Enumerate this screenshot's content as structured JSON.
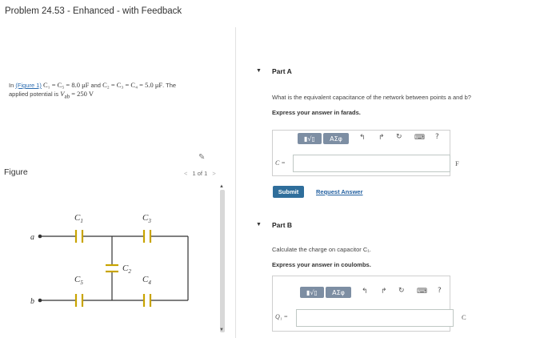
{
  "header": {
    "title": "Problem 24.53 - Enhanced - with Feedback"
  },
  "problem": {
    "intro": "In",
    "figure_link": "(Figure 1)",
    "caps1": "C₁ = C₅ = 8.0 μF",
    "and": "and",
    "caps2": "C₂ = C₃ = C₄ = 5.0 μF",
    "the": ". The",
    "line2": "applied potential is",
    "vab": "V",
    "vab_sub": "ab",
    "vab_value": "= 250 V"
  },
  "figure": {
    "label": "Figure",
    "nav": "1 of 1",
    "nodes": {
      "a": "a",
      "b": "b"
    },
    "caps": {
      "c1": "C",
      "c1_sub": "1",
      "c2": "C",
      "c2_sub": "2",
      "c3": "C",
      "c3_sub": "3",
      "c4": "C",
      "c4_sub": "4",
      "c5": "C",
      "c5_sub": "5"
    }
  },
  "partA": {
    "title": "Part A",
    "question": "What is the equivalent capacitance of the network between points a and b?",
    "instruction": "Express your answer in farads.",
    "toolbar": {
      "templates": "▮√▯",
      "greek": "ΑΣφ",
      "help": "?"
    },
    "var": "C =",
    "unit": "F",
    "submit": "Submit",
    "request": "Request Answer"
  },
  "partB": {
    "title": "Part B",
    "question": "Calculate the charge on capacitor C₁.",
    "instruction": "Express your answer in coulombs.",
    "toolbar": {
      "templates": "▮√▯",
      "greek": "ΑΣφ",
      "help": "?"
    },
    "var": "Q₁ =",
    "unit": "C"
  }
}
